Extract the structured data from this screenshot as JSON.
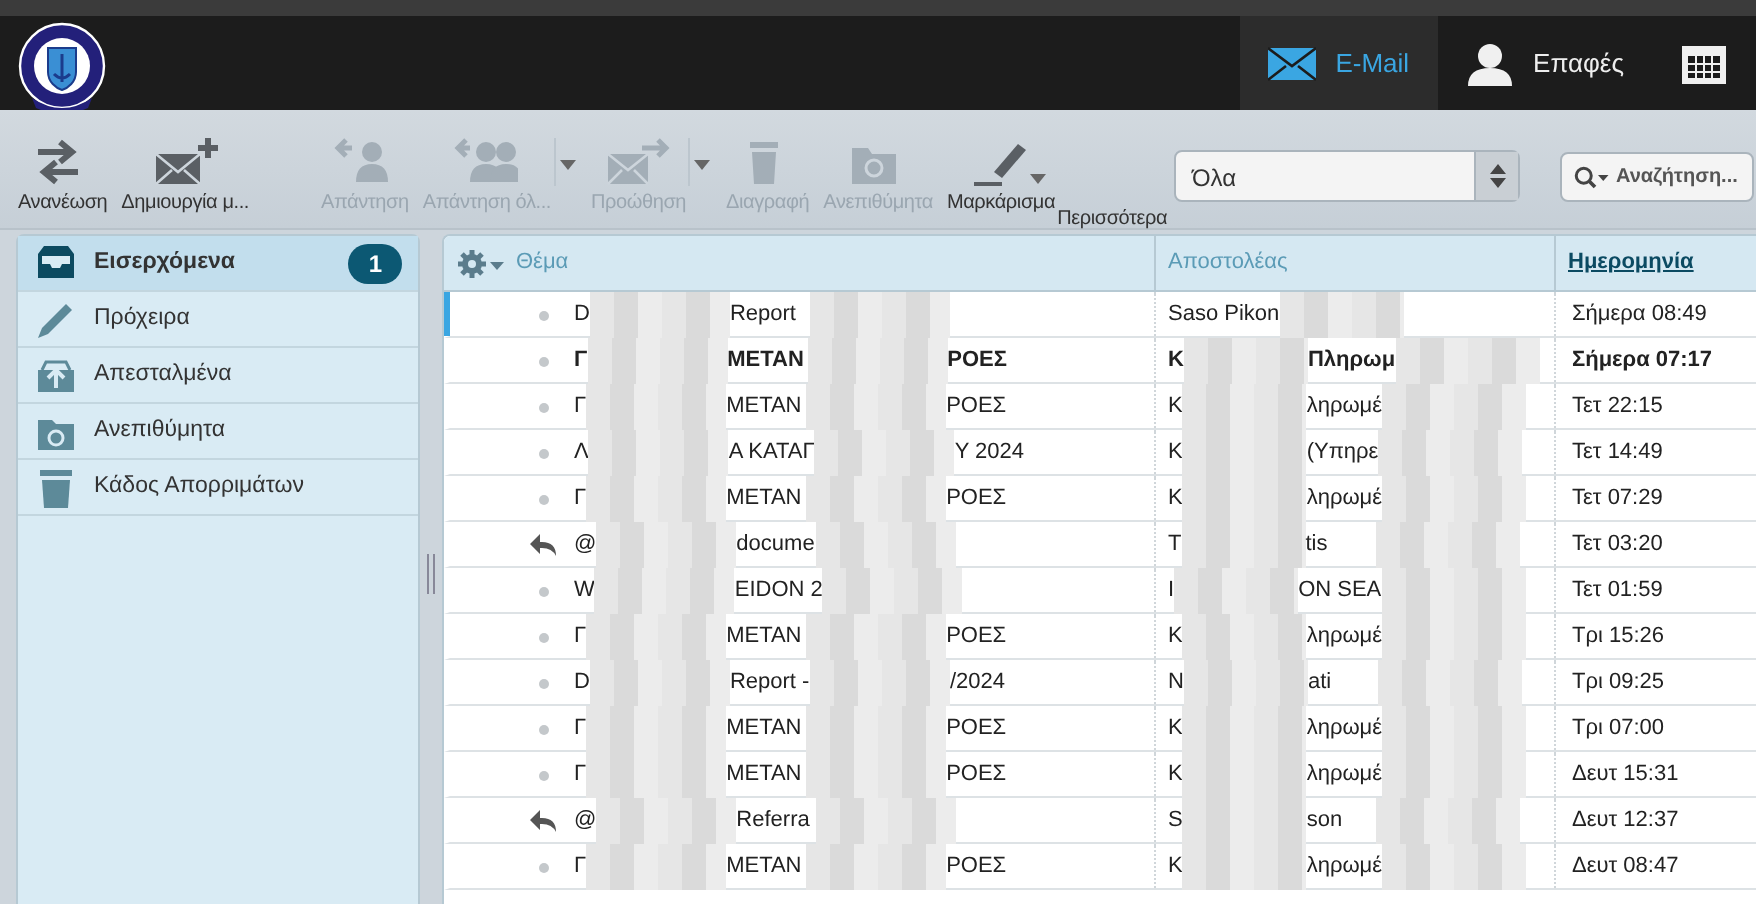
{
  "header": {
    "nav": [
      {
        "label": "E-Mail",
        "kind": "mail",
        "selected": true
      },
      {
        "label": "Επαφές",
        "kind": "contacts",
        "selected": false
      },
      {
        "kind": "calendar",
        "selected": false
      }
    ]
  },
  "toolbar": {
    "buttons": [
      {
        "label": "Ανανέωση",
        "kind": "refresh",
        "disabled": false,
        "menu": false
      },
      {
        "label": "Δημιουργία μ...",
        "kind": "compose",
        "disabled": false,
        "menu": false
      },
      {
        "label": "Απάντηση",
        "kind": "reply",
        "disabled": true,
        "menu": false
      },
      {
        "label": "Απάντηση όλ...",
        "kind": "reply-all",
        "disabled": true,
        "menu": true
      },
      {
        "label": "Προώθηση",
        "kind": "forward",
        "disabled": true,
        "menu": true
      },
      {
        "label": "Διαγραφή",
        "kind": "delete",
        "disabled": true,
        "menu": false
      },
      {
        "label": "Ανεπιθύμητα",
        "kind": "junk",
        "disabled": true,
        "menu": false
      },
      {
        "label": "Μαρκάρισμα",
        "kind": "mark",
        "disabled": false,
        "menu": true
      },
      {
        "label": "Περισσότερα",
        "kind": "more",
        "disabled": false,
        "menu": false
      }
    ],
    "filter": {
      "value": "Όλα"
    },
    "search": {
      "placeholder": "Αναζήτηση..."
    }
  },
  "folders": [
    {
      "label": "Εισερχόμενα",
      "kind": "inbox",
      "selected": true,
      "count": "1"
    },
    {
      "label": "Πρόχειρα",
      "kind": "drafts",
      "selected": false
    },
    {
      "label": "Απεσταλμένα",
      "kind": "sent",
      "selected": false
    },
    {
      "label": "Ανεπιθύμητα",
      "kind": "junk",
      "selected": false
    },
    {
      "label": "Κάδος Απορριμάτων",
      "kind": "trash",
      "selected": false
    }
  ],
  "message_list": {
    "columns": [
      {
        "label": "Θέμα",
        "sorted": false
      },
      {
        "label": "Αποστολέας",
        "sorted": false
      },
      {
        "label": "Ημερομηνία",
        "sorted": true
      }
    ],
    "rows": [
      {
        "subject": [
          "D",
          "Report"
        ],
        "sender": [
          "Saso Pikon"
        ],
        "date": "Σήμερα 08:49",
        "unread": false,
        "replied": false,
        "current": true
      },
      {
        "subject": [
          "Γ",
          "ΜΕΤΑΝ",
          "ΡΟΕΣ"
        ],
        "sender": [
          "Κ",
          "Πληρωμ"
        ],
        "date": "Σήμερα 07:17",
        "unread": true,
        "replied": false,
        "current": false
      },
      {
        "subject": [
          "Γ",
          "ΜΕΤΑΝ",
          "ΡΟΕΣ"
        ],
        "sender": [
          "Κ",
          "ληρωμέ"
        ],
        "date": "Τετ 22:15",
        "unread": false,
        "replied": false,
        "current": false
      },
      {
        "subject": [
          "Λ",
          "Α ΚΑΤΑΓ",
          "Υ 2024"
        ],
        "sender": [
          "Κ",
          "(Υπηρε"
        ],
        "date": "Τετ 14:49",
        "unread": false,
        "replied": false,
        "current": false
      },
      {
        "subject": [
          "Γ",
          "ΜΕΤΑΝ",
          "ΡΟΕΣ"
        ],
        "sender": [
          "Κ",
          "ληρωμέ"
        ],
        "date": "Τετ 07:29",
        "unread": false,
        "replied": false,
        "current": false
      },
      {
        "subject": [
          "@",
          "docume"
        ],
        "sender": [
          "Τ",
          "tis"
        ],
        "date": "Τετ 03:20",
        "unread": false,
        "replied": true,
        "current": false
      },
      {
        "subject": [
          "W",
          "EIDON 2"
        ],
        "sender": [
          "I",
          "ON SEA"
        ],
        "date": "Τετ 01:59",
        "unread": false,
        "replied": false,
        "current": false
      },
      {
        "subject": [
          "Γ",
          "ΜΕΤΑΝ",
          "ΡΟΕΣ"
        ],
        "sender": [
          "Κ",
          "ληρωμέ"
        ],
        "date": "Τρι 15:26",
        "unread": false,
        "replied": false,
        "current": false
      },
      {
        "subject": [
          "D",
          "Report -",
          "/2024"
        ],
        "sender": [
          "N",
          "ati"
        ],
        "date": "Τρι 09:25",
        "unread": false,
        "replied": false,
        "current": false
      },
      {
        "subject": [
          "Γ",
          "ΜΕΤΑΝ",
          "ΡΟΕΣ"
        ],
        "sender": [
          "Κ",
          "ληρωμέ"
        ],
        "date": "Τρι 07:00",
        "unread": false,
        "replied": false,
        "current": false
      },
      {
        "subject": [
          "Γ",
          "ΜΕΤΑΝ",
          "ΡΟΕΣ"
        ],
        "sender": [
          "Κ",
          "ληρωμέ"
        ],
        "date": "Δευτ 15:31",
        "unread": false,
        "replied": false,
        "current": false
      },
      {
        "subject": [
          "@",
          "Referra"
        ],
        "sender": [
          "S",
          "son"
        ],
        "date": "Δευτ 12:37",
        "unread": false,
        "replied": true,
        "current": false
      },
      {
        "subject": [
          "Γ",
          "ΜΕΤΑΝ",
          "ΡΟΕΣ"
        ],
        "sender": [
          "Κ",
          "ληρωμέ"
        ],
        "date": "Δευτ 08:47",
        "unread": false,
        "replied": false,
        "current": false
      }
    ]
  }
}
